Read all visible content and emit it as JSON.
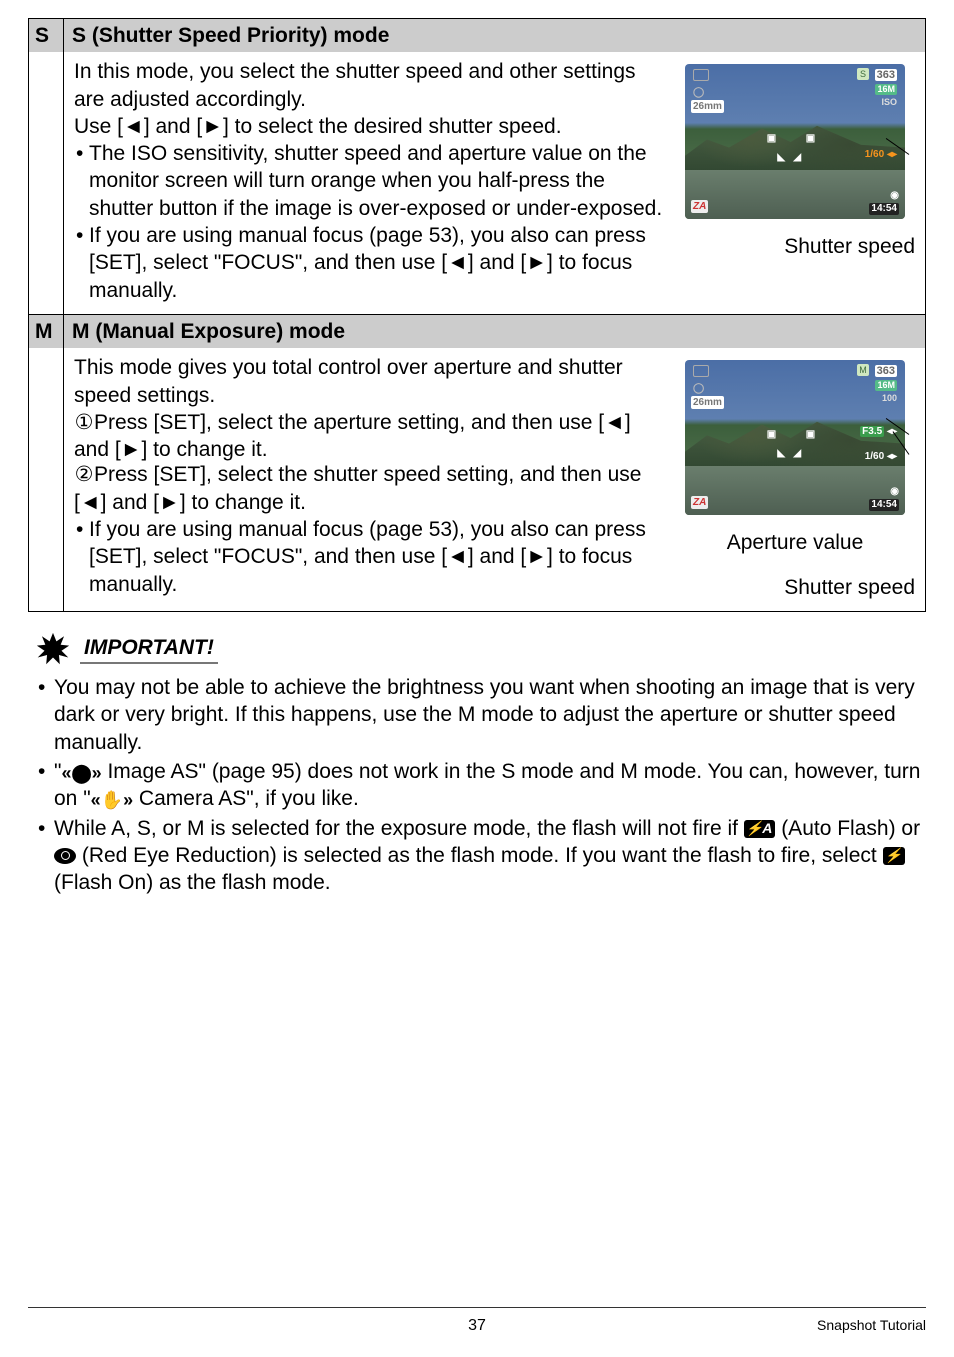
{
  "s_mode": {
    "letter": "S",
    "title": "S (Shutter Speed Priority) mode",
    "p1": "In this mode, you select the shutter speed and other settings are adjusted accordingly.",
    "p2_pre": "Use [",
    "p2_mid": "] and [",
    "p2_post": "] to select the desired shutter speed.",
    "b1": "The ISO sensitivity, shutter speed and aperture value on the monitor screen will turn orange when you half-press the shutter button if the image is over-exposed or under-exposed.",
    "b2_pre": "If you are using manual focus (page 53), you also can press [SET], select \"FOCUS\", and then use [",
    "b2_mid": "] and [",
    "b2_post": "] to focus manually.",
    "caption": "Shutter speed",
    "lcd": {
      "count": "363",
      "res": "16M",
      "iso": "ISO",
      "mm": "26mm",
      "letter": "S",
      "shutter": "1/60",
      "time": "14:54",
      "bl": "ZA"
    }
  },
  "m_mode": {
    "letter": "M",
    "title": "M (Manual Exposure) mode",
    "p1": "This mode gives you total control over aperture and shutter speed settings.",
    "step1_pre": "Press [SET], select the aperture setting, and then use [",
    "step1_mid": "] and [",
    "step1_post": "] to change it.",
    "step2_pre": "Press [SET], select the shutter speed setting, and then use [",
    "step2_mid": "] and [",
    "step2_post": "] to change it.",
    "b1_pre": "If you are using manual focus (page 53), you also can press [SET], select \"FOCUS\", and then use [",
    "b1_mid": "] and [",
    "b1_post": "] to focus manually.",
    "caption1": "Aperture value",
    "caption2": "Shutter speed",
    "lcd": {
      "count": "363",
      "res": "16M",
      "iso": "100",
      "mm": "26mm",
      "letter": "M",
      "aperture": "F3.5",
      "shutter": "1/60",
      "time": "14:54",
      "bl": "ZA"
    },
    "circ1": "①",
    "circ2": "②"
  },
  "important": {
    "label": "IMPORTANT!",
    "b1": "You may not be able to achieve the brightness you want when shooting an image that is very dark or very bright. If this happens, use the M mode to adjust the aperture or shutter speed manually.",
    "b2_pre": "\"",
    "b2_mid": " Image AS\" (page 95) does not work in the S mode and M mode. You can, however, turn on \"",
    "b2_post": " Camera AS\", if you like.",
    "b3_pre": "While A, S, or M is selected for the exposure mode, the flash will not fire if ",
    "b3_mid1": " (Auto Flash) or ",
    "b3_mid2": " (Red Eye Reduction) is selected as the flash mode. If you want the flash to fire, select ",
    "b3_post": " (Flash On) as the flash mode."
  },
  "footer": {
    "page": "37",
    "section": "Snapshot Tutorial"
  },
  "glyphs": {
    "left": "◄",
    "right": "►",
    "flashA": "⚡A",
    "flash": "⚡",
    "shake": "«⬤»",
    "hand": "«✋»"
  }
}
